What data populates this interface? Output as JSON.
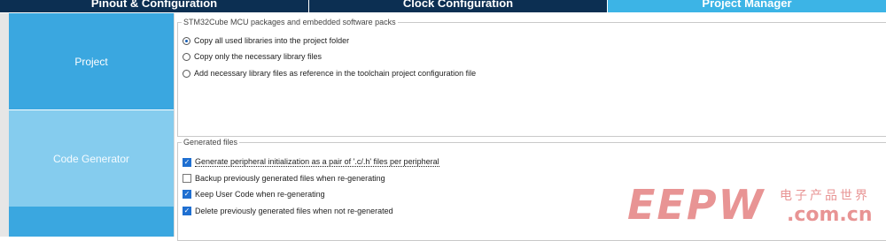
{
  "tabs": [
    {
      "label": "Pinout & Configuration",
      "active": false
    },
    {
      "label": "Clock Configuration",
      "active": false
    },
    {
      "label": "Project Manager",
      "active": true
    }
  ],
  "sidebar": {
    "items": [
      {
        "label": "Project",
        "selected": false
      },
      {
        "label": "Code Generator",
        "selected": true
      },
      {
        "label": "",
        "selected": false
      }
    ]
  },
  "packs_group": {
    "legend": "STM32Cube MCU packages and embedded software packs",
    "options": [
      {
        "label": "Copy all used libraries into the project folder",
        "checked": true
      },
      {
        "label": "Copy only the necessary library files",
        "checked": false
      },
      {
        "label": "Add necessary library files as reference in the toolchain project configuration file",
        "checked": false
      }
    ]
  },
  "generated_group": {
    "legend": "Generated files",
    "options": [
      {
        "label": "Generate peripheral initialization as a pair of '.c/.h' files per peripheral",
        "checked": true
      },
      {
        "label": "Backup previously generated files when re-generating",
        "checked": false
      },
      {
        "label": "Keep User Code when re-generating",
        "checked": true
      },
      {
        "label": "Delete previously generated files when not re-generated",
        "checked": true
      }
    ]
  },
  "watermark": {
    "brand": "EEPW",
    "chinese": "电子产品世界",
    "domain": ".com.cn",
    "color": "#d63c3c"
  },
  "colors": {
    "tab_dark": "#0c2f52",
    "tab_active": "#3cb4e6",
    "nav_blue": "#3aa7e0",
    "nav_selected": "#85ccee"
  }
}
